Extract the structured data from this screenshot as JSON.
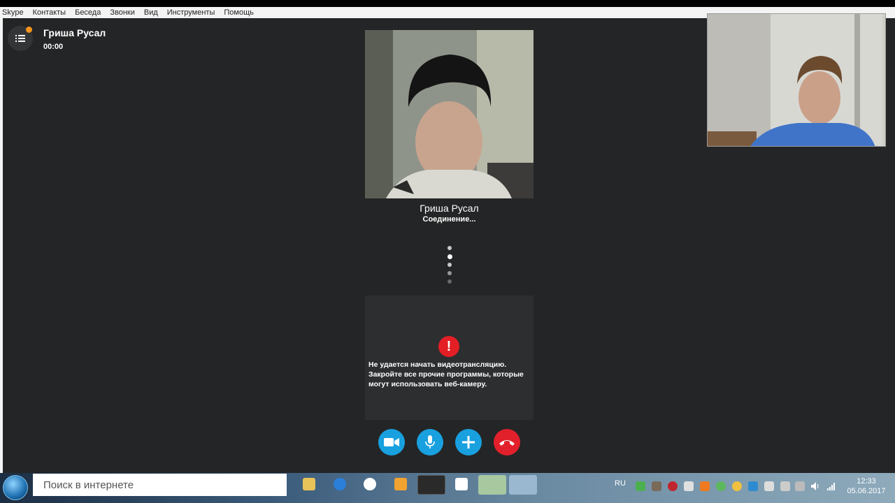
{
  "menu": [
    "Skype",
    "Контакты",
    "Беседа",
    "Звонки",
    "Вид",
    "Инструменты",
    "Помощь"
  ],
  "header": {
    "contact_name": "Гриша Русал",
    "timer": "00:00"
  },
  "call": {
    "callee_name": "Гриша Русал",
    "status": "Соединение..."
  },
  "error": {
    "message": "Не удается начать видеотрансляцию. Закройте все прочие программы, которые могут использовать веб-камеру."
  },
  "controls": [
    {
      "name": "video-button",
      "icon": "video-camera-icon"
    },
    {
      "name": "mute-button",
      "icon": "microphone-icon"
    },
    {
      "name": "add-button",
      "icon": "plus-icon"
    },
    {
      "name": "end-call-button",
      "icon": "hang-up-icon"
    }
  ],
  "taskbar": {
    "search_placeholder": "Поиск в интернете",
    "language": "RU",
    "time": "12:33",
    "date": "05.06.2017"
  },
  "colors": {
    "accent": "#18a0df",
    "end_call": "#e2202b",
    "notification": "#f7941d",
    "background": "#242526"
  }
}
